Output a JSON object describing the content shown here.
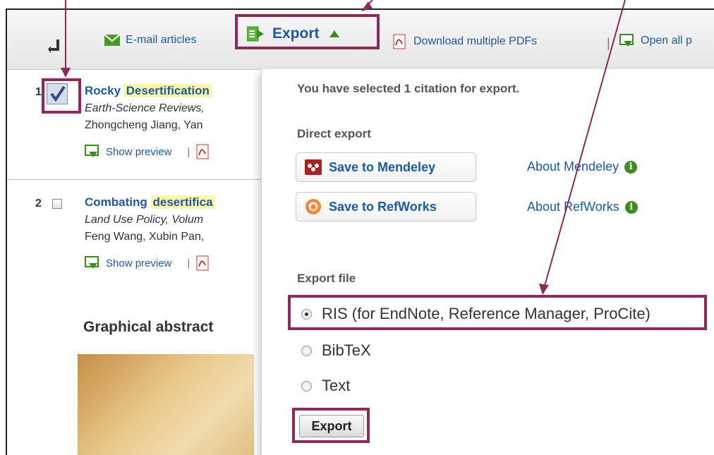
{
  "toolbar": {
    "email_label": "E-mail articles",
    "export_label": "Export",
    "download_label": "Download multiple PDFs",
    "separator": "|",
    "open_label": "Open all p"
  },
  "results": [
    {
      "number": "1",
      "checked": true,
      "title_prefix": "Rocky",
      "title_highlight": "Desertification",
      "journal": "Earth-Science Reviews,",
      "authors": "Zhongcheng Jiang, Yan",
      "preview": "Show preview"
    },
    {
      "number": "2",
      "checked": false,
      "title_prefix": "Combating",
      "title_highlight": "desertifica",
      "journal": "Land Use Policy, Volum",
      "authors": "Feng Wang, Xubin Pan,",
      "preview": "Show preview"
    }
  ],
  "preview_separator": "|",
  "graphical_abstract": "Graphical abstract",
  "panel": {
    "selected_text": "You have selected 1 citation for export.",
    "direct_export": "Direct export",
    "mendeley_button": "Save to Mendeley",
    "refworks_button": "Save to RefWorks",
    "about_mendeley": "About Mendeley",
    "about_refworks": "About RefWorks",
    "info_glyph": "i",
    "export_file": "Export file",
    "options": [
      {
        "label": "RIS (for EndNote, Reference Manager, ProCite)",
        "selected": true
      },
      {
        "label": "BibTeX",
        "selected": false
      },
      {
        "label": "Text",
        "selected": false
      }
    ],
    "export_button": "Export"
  },
  "annotation_color": "#8b2a5b",
  "link_color": "#1c5a9e"
}
